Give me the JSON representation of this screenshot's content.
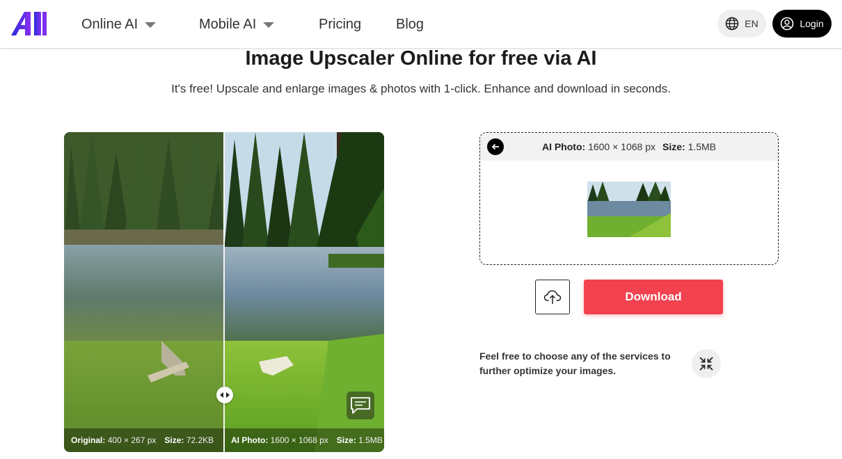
{
  "header": {
    "logo_alt": "AI",
    "nav": [
      {
        "label": "Online AI",
        "has_dropdown": true
      },
      {
        "label": "Mobile AI",
        "has_dropdown": true
      },
      {
        "label": "Pricing",
        "has_dropdown": false
      },
      {
        "label": "Blog",
        "has_dropdown": false
      }
    ],
    "language": "EN",
    "login_label": "Login"
  },
  "hero": {
    "title": "Image Upscaler Online for free via AI",
    "subtitle": "It's free! Upscale and enlarge images & photos with 1-click. Enhance and download in seconds."
  },
  "compare": {
    "original": {
      "label": "Original:",
      "dims": "400 × 267 px",
      "size_label": "Size:",
      "size": "72.2KB"
    },
    "enhanced": {
      "label": "AI Photo:",
      "dims": "1600 × 1068 px",
      "size_label": "Size:",
      "size": "1.5MB"
    }
  },
  "result": {
    "label": "AI Photo:",
    "dims": "1600 × 1068 px",
    "size_label": "Size:",
    "size": "1.5MB",
    "download_label": "Download"
  },
  "services_hint": "Feel free to choose any of the services to further optimize your images.",
  "colors": {
    "accent": "#f2424f",
    "logo_gradient": [
      "#2a2fd9",
      "#7b2ff0"
    ],
    "dark": "#000000"
  },
  "icons": {
    "language": "globe-icon",
    "login": "user-circle-icon",
    "back": "arrow-left-icon",
    "upload": "cloud-upload-icon",
    "collapse": "collapse-arrows-icon",
    "comment": "comment-icon",
    "compare_handle": "left-right-arrows-icon"
  }
}
